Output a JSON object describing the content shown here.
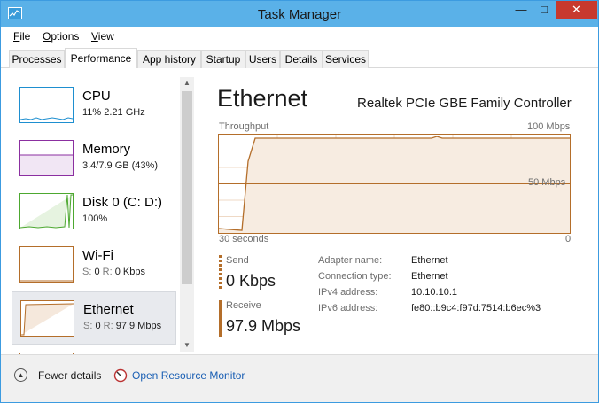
{
  "window": {
    "title": "Task Manager",
    "minimize_glyph": "—",
    "maximize_glyph": "□",
    "close_glyph": "✕"
  },
  "menu": {
    "file_u": "F",
    "file_rest": "ile",
    "options_u": "O",
    "options_rest": "ptions",
    "view_u": "V",
    "view_rest": "iew"
  },
  "tabs": [
    {
      "label": "Processes",
      "active": false
    },
    {
      "label": "Performance",
      "active": true
    },
    {
      "label": "App history",
      "active": false
    },
    {
      "label": "Startup",
      "active": false
    },
    {
      "label": "Users",
      "active": false
    },
    {
      "label": "Details",
      "active": false
    },
    {
      "label": "Services",
      "active": false
    }
  ],
  "sidebar": {
    "items": [
      {
        "name": "CPU",
        "detail": "11% 2.21 GHz",
        "color": "#1e8fd0",
        "selected": false
      },
      {
        "name": "Memory",
        "detail": "3.4/7.9 GB (43%)",
        "color": "#8b2fa0",
        "selected": false
      },
      {
        "name": "Disk 0 (C: D:)",
        "detail": "100%",
        "color": "#4da830",
        "selected": false
      },
      {
        "name": "Wi-Fi",
        "detail_s_label": "S:",
        "detail_s_val": "0",
        "detail_r_label": "R:",
        "detail_r_val": "0 Kbps",
        "color": "#b46e2a",
        "selected": false
      },
      {
        "name": "Ethernet",
        "detail_s_label": "S:",
        "detail_s_val": "0",
        "detail_r_label": "R:",
        "detail_r_val": "97.9 Mbps",
        "color": "#b46e2a",
        "selected": true
      }
    ]
  },
  "detail": {
    "title": "Ethernet",
    "adapter_model": "Realtek PCIe GBE Family Controller",
    "chart_title": "Throughput",
    "chart_max": "100 Mbps",
    "chart_mid": "50 Mbps",
    "chart_time": "30 seconds",
    "chart_min": "0",
    "send_label": "Send",
    "send_value": "0 Kbps",
    "receive_label": "Receive",
    "receive_value": "97.9 Mbps",
    "props": [
      {
        "key": "Adapter name:",
        "value": "Ethernet"
      },
      {
        "key": "Connection type:",
        "value": "Ethernet"
      },
      {
        "key": "IPv4 address:",
        "value": "10.10.10.1"
      },
      {
        "key": "IPv6 address:",
        "value": "fe80::b9c4:f97d:7514:b6ec%3"
      }
    ]
  },
  "footer": {
    "fewer_details": "Fewer details",
    "resource_monitor": "Open Resource Monitor"
  },
  "colors": {
    "titlebar": "#5ab1e8",
    "close": "#c7392e",
    "network_accent": "#b46e2a",
    "link": "#1a5fb4"
  }
}
